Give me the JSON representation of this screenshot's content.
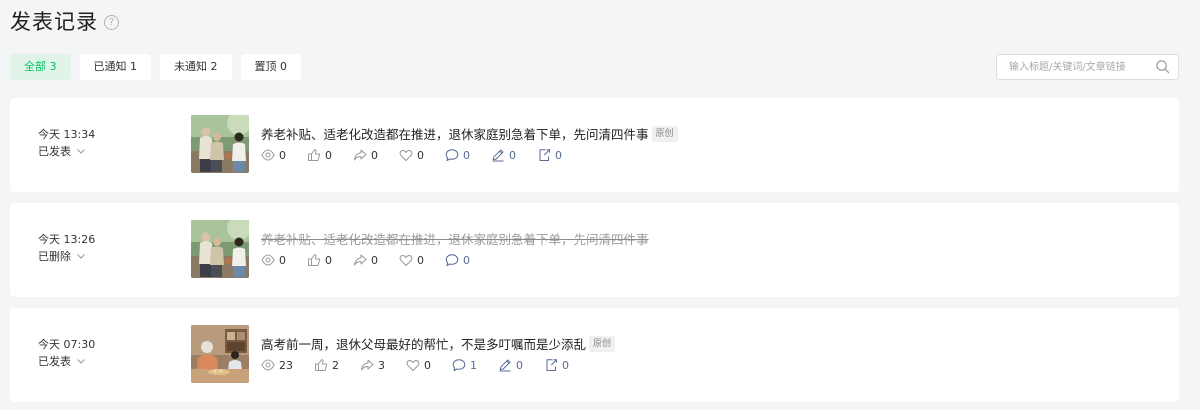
{
  "page": {
    "title": "发表记录",
    "help_glyph": "?"
  },
  "tabs": [
    {
      "label": "全部 3",
      "active": true
    },
    {
      "label": "已通知 1",
      "active": false
    },
    {
      "label": "未通知 2",
      "active": false
    },
    {
      "label": "置顶 0",
      "active": false
    }
  ],
  "search": {
    "placeholder": "输入标题/关键词/文章链接"
  },
  "colors": {
    "accent": "#07c160",
    "accent_bg": "#e0f4ea",
    "link_blue": "#576b95",
    "page_bg": "#f4f5f7"
  },
  "records": [
    {
      "time": "今天 13:34",
      "status": "已发表",
      "title": "养老补贴、适老化改造都在推进，退休家庭别急着下单，先问清四件事",
      "tag": "原创",
      "deleted": false,
      "thumbnail": "elderly-family-outdoor-photo",
      "stats": {
        "reads": "0",
        "likes": "0",
        "shares": "0",
        "favorites": "0",
        "comments": "0",
        "notes": "0",
        "reposts": "0"
      }
    },
    {
      "time": "今天 13:26",
      "status": "已删除",
      "title": "养老补贴、适老化改造都在推进，退休家庭别急着下单，先问清四件事",
      "tag": "",
      "deleted": true,
      "thumbnail": "elderly-family-outdoor-photo",
      "stats": {
        "reads": "0",
        "likes": "0",
        "shares": "0",
        "favorites": "0",
        "comments": "0"
      }
    },
    {
      "time": "今天 07:30",
      "status": "已发表",
      "title": "高考前一周，退休父母最好的帮忙，不是多叮嘱而是少添乱",
      "tag": "原创",
      "deleted": false,
      "thumbnail": "elderly-kitchen-photo",
      "stats": {
        "reads": "23",
        "likes": "2",
        "shares": "3",
        "favorites": "0",
        "comments": "1",
        "notes": "0",
        "reposts": "0"
      }
    }
  ]
}
